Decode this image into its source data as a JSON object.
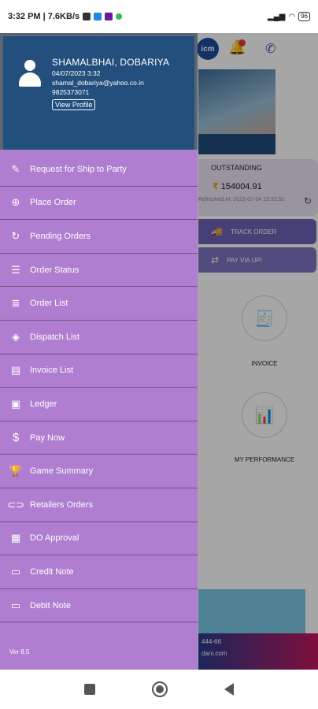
{
  "status_bar": {
    "time_speed": "3:32 PM | 7.6KB/s",
    "battery": "96"
  },
  "background_app": {
    "logo_text": "icm",
    "outstanding": {
      "title": "OUTSTANDING",
      "amount": "154004.91",
      "refreshed": "Refreshed At: 2023-07-04 15:32:51"
    },
    "track_order": "TRACK ORDER",
    "pay_via_upi": "PAY VIA UPI",
    "invoice": "INVOICE",
    "my_performance": "MY PERFORMANCE",
    "footer_phone": "444-66",
    "footer_site": "dani.com"
  },
  "drawer": {
    "user": {
      "name": "SHAMALBHAI, DOBARIYA",
      "datetime": "04/07/2023 3:32",
      "email": "shamal_dobariya@yahoo.co.in",
      "phone": "9825373071",
      "view_profile": "View Profile"
    },
    "menu_items": [
      {
        "label": "Request for Ship to Party",
        "icon": "pencil-icon"
      },
      {
        "label": "Place Order",
        "icon": "add-circle-icon"
      },
      {
        "label": "Pending Orders",
        "icon": "refresh-icon"
      },
      {
        "label": "Order Status",
        "icon": "status-icon"
      },
      {
        "label": "Order List",
        "icon": "list-icon"
      },
      {
        "label": "Dispatch List",
        "icon": "tag-icon"
      },
      {
        "label": "Invoice List",
        "icon": "document-icon"
      },
      {
        "label": "Ledger",
        "icon": "ledger-icon"
      },
      {
        "label": "Pay Now",
        "icon": "dollar-icon"
      },
      {
        "label": "Game Summary",
        "icon": "trophy-icon"
      },
      {
        "label": "Retailers Orders",
        "icon": "link-icon"
      },
      {
        "label": "DO Approval",
        "icon": "approval-icon"
      },
      {
        "label": "Credit Note",
        "icon": "card-icon"
      },
      {
        "label": "Debit Note",
        "icon": "card-icon"
      }
    ],
    "version": "Ver 8.5"
  }
}
